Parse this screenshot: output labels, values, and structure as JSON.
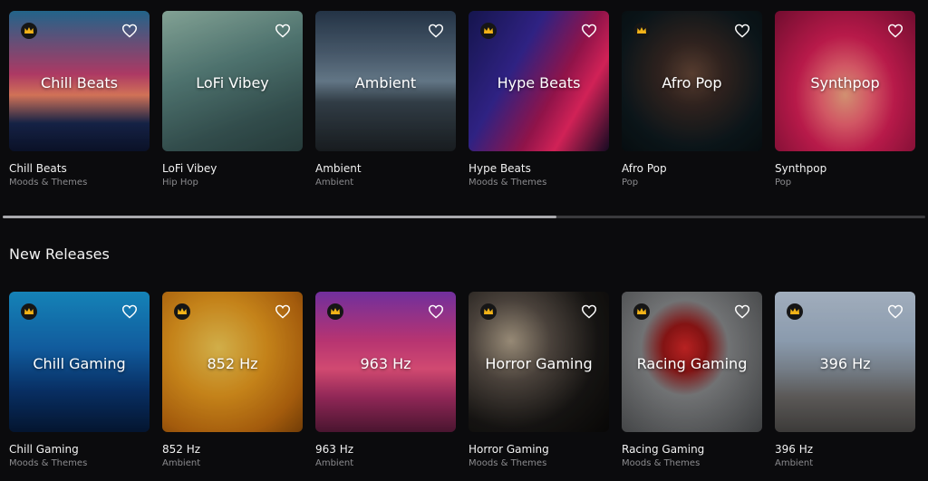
{
  "rows": [
    {
      "items": [
        {
          "overlay": "Chill Beats",
          "title": "Chill Beats",
          "subtitle": "Moods & Themes",
          "premium": true
        },
        {
          "overlay": "LoFi Vibey",
          "title": "LoFi Vibey",
          "subtitle": "Hip Hop",
          "premium": false
        },
        {
          "overlay": "Ambient",
          "title": "Ambient",
          "subtitle": "Ambient",
          "premium": false
        },
        {
          "overlay": "Hype Beats",
          "title": "Hype Beats",
          "subtitle": "Moods & Themes",
          "premium": true
        },
        {
          "overlay": "Afro Pop",
          "title": "Afro Pop",
          "subtitle": "Pop",
          "premium": true
        },
        {
          "overlay": "Synthpop",
          "title": "Synthpop",
          "subtitle": "Pop",
          "premium": false
        }
      ]
    },
    {
      "section_title": "New Releases",
      "items": [
        {
          "overlay": "Chill Gaming",
          "title": "Chill Gaming",
          "subtitle": "Moods & Themes",
          "premium": true
        },
        {
          "overlay": "852 Hz",
          "title": "852 Hz",
          "subtitle": "Ambient",
          "premium": true
        },
        {
          "overlay": "963 Hz",
          "title": "963 Hz",
          "subtitle": "Ambient",
          "premium": true
        },
        {
          "overlay": "Horror Gaming",
          "title": "Horror Gaming",
          "subtitle": "Moods & Themes",
          "premium": true
        },
        {
          "overlay": "Racing Gaming",
          "title": "Racing Gaming",
          "subtitle": "Moods & Themes",
          "premium": true
        },
        {
          "overlay": "396 Hz",
          "title": "396 Hz",
          "subtitle": "Ambient",
          "premium": true
        }
      ]
    }
  ],
  "scroll": {
    "position_fraction": 0.6
  },
  "colors": {
    "background": "#0b0b0d",
    "crown": "#f2b318",
    "subtitle": "#8b8b8e"
  },
  "icons": {
    "premium": "crown-icon",
    "favorite": "heart-icon"
  }
}
